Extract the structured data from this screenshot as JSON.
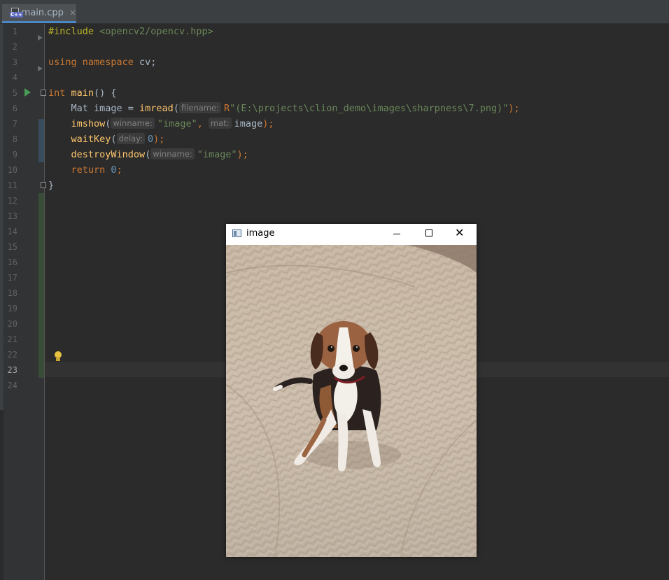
{
  "tab": {
    "label": "main.cpp",
    "icon": "cpp-file-icon",
    "close": "×"
  },
  "line_numbers": [
    "1",
    "2",
    "3",
    "4",
    "5",
    "6",
    "7",
    "8",
    "9",
    "10",
    "11",
    "12",
    "13",
    "14",
    "15",
    "16",
    "17",
    "18",
    "19",
    "20",
    "21",
    "22",
    "23",
    "24"
  ],
  "current_line": "23",
  "code": {
    "l1": {
      "directive": "#include",
      "path": " <opencv2/opencv.hpp>"
    },
    "l3": {
      "kw1": "using",
      "kw2": " namespace",
      "rest": " cv;"
    },
    "l5": {
      "type": "int",
      "name": " main",
      "rest": "() {"
    },
    "l6": {
      "pre": "    Mat image = ",
      "fn": "imread",
      "open": "(",
      "hint": "filename:",
      "raw": "R",
      "str": "\"(E:\\projects\\clion_demo\\images\\sharpness\\7.png)\"",
      "close": ");"
    },
    "l7": {
      "pre": "    ",
      "fn": "imshow",
      "open": "(",
      "hint1": "winname:",
      "str": "\"image\"",
      "comma": ", ",
      "hint2": "mat:",
      "arg": "image",
      "close": ");"
    },
    "l8": {
      "pre": "    ",
      "fn": "waitKey",
      "open": "(",
      "hint": "delay:",
      "num": "0",
      "close": ");"
    },
    "l9": {
      "pre": "    ",
      "fn": "destroyWindow",
      "open": "(",
      "hint": "winname:",
      "str": "\"image\"",
      "close": ");"
    },
    "l10": {
      "pre": "    ",
      "kw": "return",
      "num": " 0",
      "close": ";"
    },
    "l11": {
      "text": "}"
    }
  },
  "cv_window": {
    "title": "image",
    "minimize": "minimize-icon",
    "maximize": "maximize-icon",
    "close": "✕",
    "image_desc": "beagle-photo"
  },
  "colors": {
    "background": "#2b2b2b",
    "keyword": "#cc7832",
    "function": "#ffc66d",
    "string": "#6a8759",
    "number": "#6897bb"
  }
}
